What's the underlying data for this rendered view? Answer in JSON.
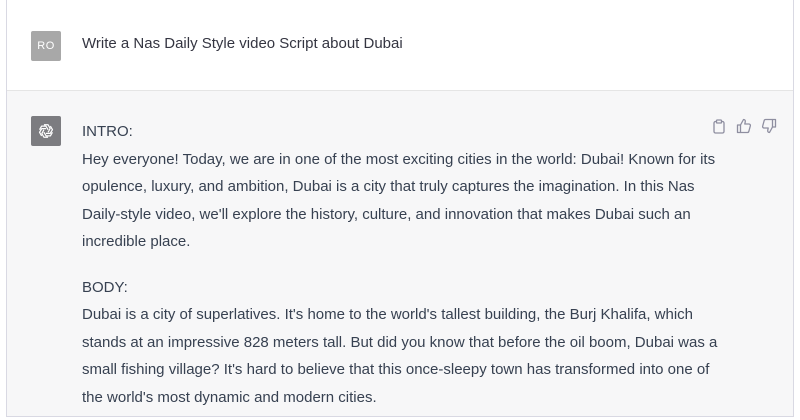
{
  "user_message": {
    "avatar_initials": "RO",
    "text": "Write a Nas Daily Style video Script about Dubai"
  },
  "assistant_message": {
    "avatar_icon": "openai-logo-icon",
    "intro_heading": "INTRO:",
    "intro_text": "Hey everyone! Today, we are in one of the most exciting cities in the world: Dubai! Known for its opulence, luxury, and ambition, Dubai is a city that truly captures the imagination. In this Nas Daily-style video, we'll explore the history, culture, and innovation that makes Dubai such an incredible place.",
    "body_heading": "BODY:",
    "body_text": "Dubai is a city of superlatives. It's home to the world's tallest building, the Burj Khalifa, which stands at an impressive 828 meters tall. But did you know that before the oil boom, Dubai was a small fishing village? It's hard to believe that this once-sleepy town has transformed into one of the world's most dynamic and modern cities."
  },
  "actions": {
    "copy_icon": "clipboard-icon",
    "like_icon": "thumbs-up-icon",
    "dislike_icon": "thumbs-down-icon"
  },
  "colors": {
    "assistant_bg": "#f7f7f8",
    "user_avatar": "#a8a8a8",
    "assistant_avatar": "#7c7c80",
    "text": "#374151"
  }
}
